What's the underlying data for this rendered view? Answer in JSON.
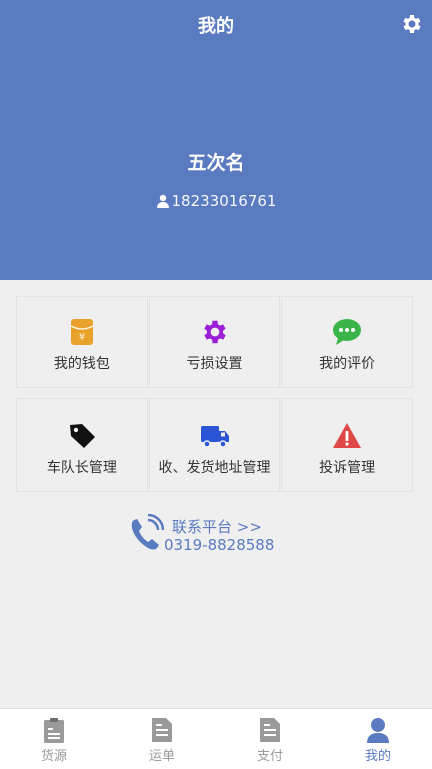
{
  "header": {
    "title": "我的",
    "user_name": "五次名",
    "phone": "18233016761"
  },
  "menu": [
    {
      "label": "我的钱包",
      "icon": "wallet-icon",
      "color": "#e8a12a"
    },
    {
      "label": "亏损设置",
      "icon": "gear-icon",
      "color": "#9b1fd6"
    },
    {
      "label": "我的评价",
      "icon": "chat-bubble-icon",
      "color": "#3bb54a"
    },
    {
      "label": "车队长管理",
      "icon": "tag-icon",
      "color": "#111111"
    },
    {
      "label": "收、发货地址管理",
      "icon": "truck-icon",
      "color": "#2c55d6"
    },
    {
      "label": "投诉管理",
      "icon": "warning-icon",
      "color": "#e04848"
    }
  ],
  "contact": {
    "label": "联系平台 >>",
    "phone": "0319-8828588"
  },
  "tabs": [
    {
      "label": "货源",
      "icon": "clipboard-icon",
      "active": false
    },
    {
      "label": "运单",
      "icon": "document-icon",
      "active": false
    },
    {
      "label": "支付",
      "icon": "document-icon",
      "active": false
    },
    {
      "label": "我的",
      "icon": "user-icon",
      "active": true
    }
  ],
  "colors": {
    "brand": "#5b7bc0",
    "tab_inactive": "#9a9a9a",
    "background": "#efefef"
  }
}
